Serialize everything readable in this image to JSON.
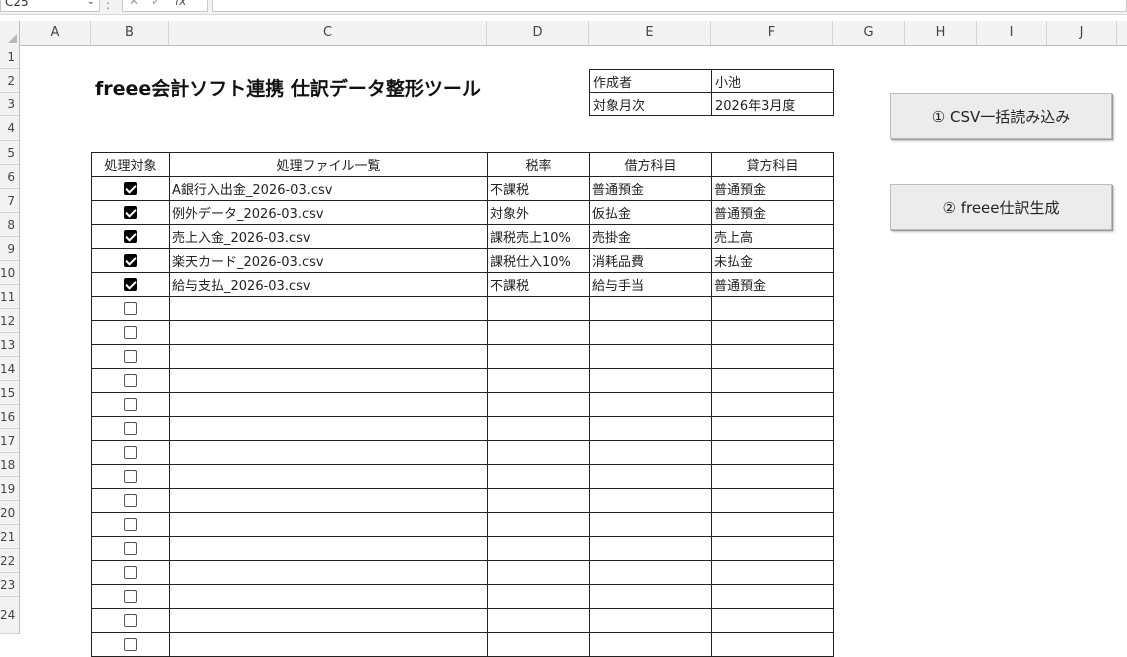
{
  "name_box": "C25",
  "formula_bar": {
    "cancel_glyph": "✕",
    "enter_glyph": "✓",
    "fx_label": "fx",
    "separator": ":"
  },
  "columns": [
    "A",
    "B",
    "C",
    "D",
    "E",
    "F",
    "G",
    "H",
    "I",
    "J"
  ],
  "rows": [
    "1",
    "2",
    "3",
    "4",
    "5",
    "6",
    "7",
    "8",
    "9",
    "10",
    "11",
    "12",
    "13",
    "14",
    "15",
    "16",
    "17",
    "18",
    "19",
    "20",
    "21",
    "22",
    "23",
    "24"
  ],
  "title": "freee会計ソフト連携 仕訳データ整形ツール",
  "info": {
    "author_label": "作成者",
    "author_value": "小池",
    "month_label": "対象月次",
    "month_value": "2026年3月度"
  },
  "table": {
    "headers": [
      "処理対象",
      "処理ファイル一覧",
      "税率",
      "借方科目",
      "貸方科目"
    ],
    "rows": [
      {
        "checked": true,
        "file": "A銀行入出金_2026-03.csv",
        "tax": "不課税",
        "debit": "普通預金",
        "credit": "普通預金"
      },
      {
        "checked": true,
        "file": "例外データ_2026-03.csv",
        "tax": "対象外",
        "debit": "仮払金",
        "credit": "普通預金"
      },
      {
        "checked": true,
        "file": "売上入金_2026-03.csv",
        "tax": "課税売上10%",
        "debit": "売掛金",
        "credit": "売上高"
      },
      {
        "checked": true,
        "file": "楽天カード_2026-03.csv",
        "tax": "課税仕入10%",
        "debit": "消耗品費",
        "credit": "未払金"
      },
      {
        "checked": true,
        "file": "給与支払_2026-03.csv",
        "tax": "不課税",
        "debit": "給与手当",
        "credit": "普通預金"
      },
      {
        "checked": false,
        "file": "",
        "tax": "",
        "debit": "",
        "credit": ""
      },
      {
        "checked": false,
        "file": "",
        "tax": "",
        "debit": "",
        "credit": ""
      },
      {
        "checked": false,
        "file": "",
        "tax": "",
        "debit": "",
        "credit": ""
      },
      {
        "checked": false,
        "file": "",
        "tax": "",
        "debit": "",
        "credit": ""
      },
      {
        "checked": false,
        "file": "",
        "tax": "",
        "debit": "",
        "credit": ""
      },
      {
        "checked": false,
        "file": "",
        "tax": "",
        "debit": "",
        "credit": ""
      },
      {
        "checked": false,
        "file": "",
        "tax": "",
        "debit": "",
        "credit": ""
      },
      {
        "checked": false,
        "file": "",
        "tax": "",
        "debit": "",
        "credit": ""
      },
      {
        "checked": false,
        "file": "",
        "tax": "",
        "debit": "",
        "credit": ""
      },
      {
        "checked": false,
        "file": "",
        "tax": "",
        "debit": "",
        "credit": ""
      },
      {
        "checked": false,
        "file": "",
        "tax": "",
        "debit": "",
        "credit": ""
      },
      {
        "checked": false,
        "file": "",
        "tax": "",
        "debit": "",
        "credit": ""
      },
      {
        "checked": false,
        "file": "",
        "tax": "",
        "debit": "",
        "credit": ""
      },
      {
        "checked": false,
        "file": "",
        "tax": "",
        "debit": "",
        "credit": ""
      },
      {
        "checked": false,
        "file": "",
        "tax": "",
        "debit": "",
        "credit": ""
      }
    ]
  },
  "buttons": {
    "import_csv": "① CSV一括読み込み",
    "generate": "② freee仕訳生成"
  }
}
